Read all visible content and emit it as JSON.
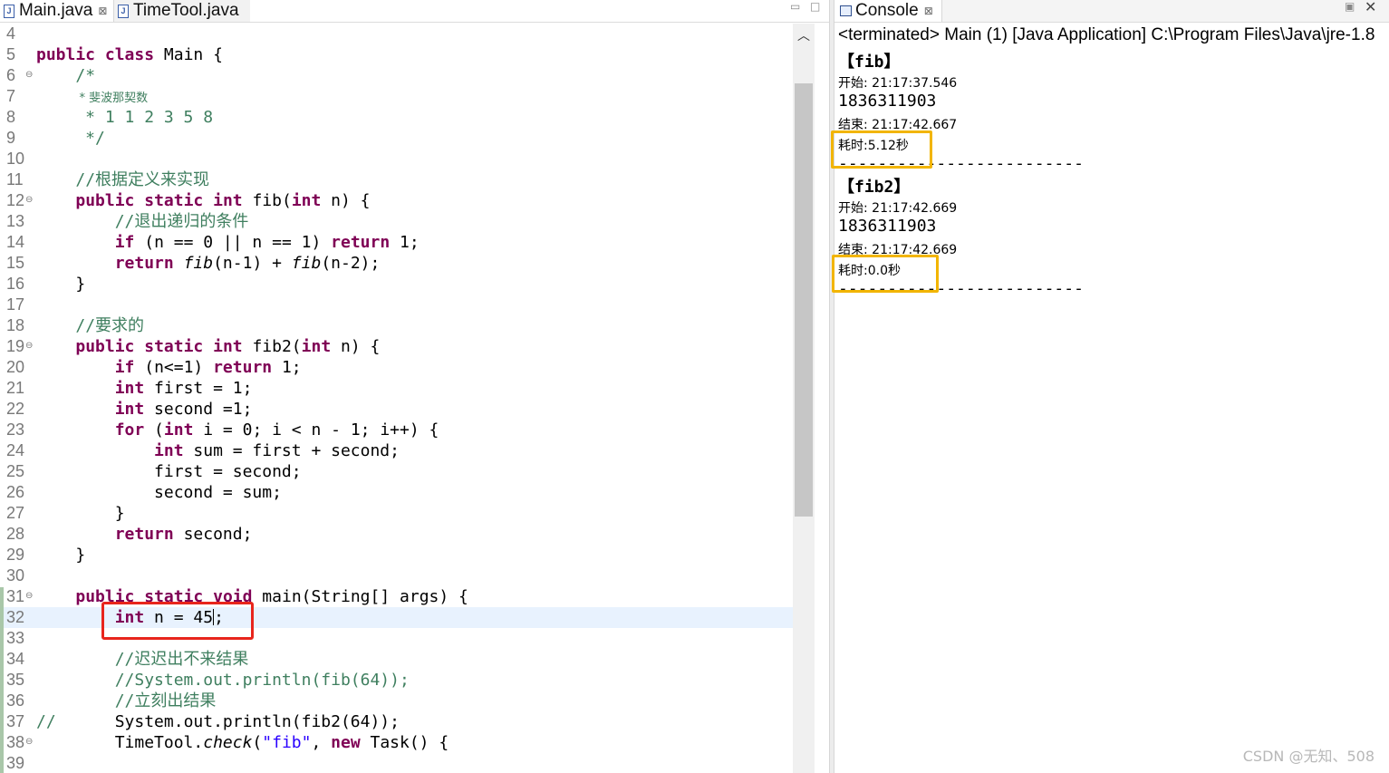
{
  "editor": {
    "tabs": [
      {
        "label": "Main.java",
        "active": true
      },
      {
        "label": "TimeTool.java",
        "active": false
      }
    ],
    "close_glyph": "⊠",
    "lines": [
      {
        "n": "4",
        "html": ""
      },
      {
        "n": "5",
        "html": "<span class=\"kw\">public</span> <span class=\"kw\">class</span> Main {"
      },
      {
        "n": "6",
        "fold": true,
        "html": "    <span class=\"cm\">/*</span>"
      },
      {
        "n": "7",
        "html": "    <span class=\"small-cm\"> * 斐波那契数</span>"
      },
      {
        "n": "8",
        "html": "<span class=\"cm\">     * 1 1 2 3 5 8</span>"
      },
      {
        "n": "9",
        "html": "<span class=\"cm\">     */</span>"
      },
      {
        "n": "10",
        "html": ""
      },
      {
        "n": "11",
        "html": "    <span class=\"cm\">//<span class=\"ch\">根据定义来实现</span></span>"
      },
      {
        "n": "12",
        "fold": true,
        "html": "    <span class=\"kw\">public</span> <span class=\"kw\">static</span> <span class=\"kw\">int</span> fib(<span class=\"kw\">int</span> n) {"
      },
      {
        "n": "13",
        "html": "        <span class=\"cm\">//<span class=\"ch\">退出递归的条件</span></span>"
      },
      {
        "n": "14",
        "html": "        <span class=\"kw\">if</span> (n == 0 || n == 1) <span class=\"kw\">return</span> 1;"
      },
      {
        "n": "15",
        "html": "        <span class=\"kw\">return</span> <span class=\"it\">fib</span>(n-1) + <span class=\"it\">fib</span>(n-2);"
      },
      {
        "n": "16",
        "html": "    }"
      },
      {
        "n": "17",
        "html": ""
      },
      {
        "n": "18",
        "html": "    <span class=\"cm\">//<span class=\"ch\">要求的</span></span>"
      },
      {
        "n": "19",
        "fold": true,
        "html": "    <span class=\"kw\">public</span> <span class=\"kw\">static</span> <span class=\"kw\">int</span> fib2(<span class=\"kw\">int</span> n) {"
      },
      {
        "n": "20",
        "html": "        <span class=\"kw\">if</span> (n&lt;=1) <span class=\"kw\">return</span> 1;"
      },
      {
        "n": "21",
        "html": "        <span class=\"kw\">int</span> first = 1;"
      },
      {
        "n": "22",
        "html": "        <span class=\"kw\">int</span> second =1;"
      },
      {
        "n": "23",
        "html": "        <span class=\"kw\">for</span> (<span class=\"kw\">int</span> i = 0; i &lt; n - 1; i++) {"
      },
      {
        "n": "24",
        "html": "            <span class=\"kw\">int</span> sum = first + second;"
      },
      {
        "n": "25",
        "html": "            first = second;"
      },
      {
        "n": "26",
        "html": "            second = sum;"
      },
      {
        "n": "27",
        "html": "        }"
      },
      {
        "n": "28",
        "html": "        <span class=\"kw\">return</span> second;"
      },
      {
        "n": "29",
        "html": "    }"
      },
      {
        "n": "30",
        "html": ""
      },
      {
        "n": "31",
        "fold": true,
        "html": "    <span class=\"kw\">public</span> <span class=\"kw\">static</span> <span class=\"kw\">void</span> main(String[] args) {"
      },
      {
        "n": "32",
        "current": true,
        "html": "        <span class=\"kw\">int</span> n = 45<span class=\"cursor-caret\"></span>;"
      },
      {
        "n": "33",
        "html": ""
      },
      {
        "n": "34",
        "html": "        <span class=\"cm\">//<span class=\"ch\">迟迟出不来结果</span></span>"
      },
      {
        "n": "35",
        "html": "        <span class=\"cm\">//System.out.println(fib(64));</span>"
      },
      {
        "n": "36",
        "html": "        <span class=\"cm\">//<span class=\"ch\">立刻出结果</span></span>"
      },
      {
        "n": "37",
        "html": "<span class=\"cm\">//</span>      System.out.println(fib2(64));"
      },
      {
        "n": "38",
        "fold": true,
        "html": "        TimeTool.<span class=\"it\">check</span>(<span class=\"str\">\"fib\"</span>, <span class=\"kw\">new</span> Task() {"
      },
      {
        "n": "39",
        "html": ""
      }
    ]
  },
  "console": {
    "tab_label": "Console",
    "status": "<terminated> Main (1) [Java Application] C:\\Program Files\\Java\\jre-1.8",
    "blocks": [
      {
        "title": "【fib】",
        "start": "开始: 21:17:37.546",
        "result": "1836311903",
        "end": "结束: 21:17:42.667",
        "elapsed": "耗时:5.12秒",
        "separator": "-------------------------"
      },
      {
        "title": "【fib2】",
        "start": "开始: 21:17:42.669",
        "result": "1836311903",
        "end": "结束: 21:17:42.669",
        "elapsed": "耗时:0.0秒",
        "separator": "-------------------------"
      }
    ]
  },
  "watermark": "CSDN @无知、508",
  "colors": {
    "keyword": "#7f0055",
    "comment": "#3f7f5f",
    "string": "#2a00ff",
    "current_line": "#e8f2fe",
    "highlight_red": "#e8251c",
    "highlight_yellow": "#f2b500"
  }
}
